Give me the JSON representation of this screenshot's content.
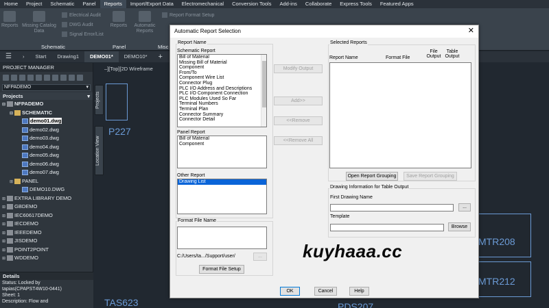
{
  "ribbon": {
    "tabs": [
      "Home",
      "Project",
      "Schematic",
      "Panel",
      "Reports",
      "Import/Export Data",
      "Electromechanical",
      "Conversion Tools",
      "Add-ins",
      "Collaborate",
      "Express Tools",
      "Featured Apps"
    ],
    "active_tab": "Reports",
    "buttons": {
      "reports": "Reports",
      "missing_catalog_data": "Missing Catalog Data",
      "electrical_audit": "Electrical Audit",
      "dwg_audit": "DWG Audit",
      "signal_error_list": "Signal Error/List",
      "reports_panel": "Reports",
      "automatic_reports": "Automatic Reports",
      "report_format_setup": "Report Format Setup"
    },
    "groups": {
      "schematic": "Schematic",
      "panel": "Panel",
      "misc": "Misc"
    }
  },
  "file_tabs": [
    "Start",
    "Drawing1",
    "DEMO01*",
    "DEMO10*"
  ],
  "active_file_tab": "DEMO01*",
  "viewport_label": "–][Top][2D Wireframe",
  "project_manager": {
    "title": "PROJECT MANAGER",
    "selected_project": "NFPADEMO",
    "projects_label": "Projects",
    "side_tabs": {
      "projects": "Projects",
      "location_view": "Location View"
    },
    "tree": [
      {
        "label": "NFPADEMO",
        "level": 0,
        "type": "proj",
        "bold": true,
        "expanded": true
      },
      {
        "label": "SCHEMATIC",
        "level": 1,
        "type": "folder",
        "bold": true,
        "expanded": true
      },
      {
        "label": "demo01.dwg",
        "level": 2,
        "type": "dwg",
        "bold": true,
        "selected": true
      },
      {
        "label": "demo02.dwg",
        "level": 2,
        "type": "dwg"
      },
      {
        "label": "demo03.dwg",
        "level": 2,
        "type": "dwg"
      },
      {
        "label": "demo04.dwg",
        "level": 2,
        "type": "dwg"
      },
      {
        "label": "demo05.dwg",
        "level": 2,
        "type": "dwg"
      },
      {
        "label": "demo06.dwg",
        "level": 2,
        "type": "dwg"
      },
      {
        "label": "demo07.dwg",
        "level": 2,
        "type": "dwg"
      },
      {
        "label": "PANEL",
        "level": 1,
        "type": "folder",
        "collapsed": true
      },
      {
        "label": "DEMO10.DWG",
        "level": 2,
        "type": "dwg"
      },
      {
        "label": "EXTRA LIBRARY DEMO",
        "level": 0,
        "type": "proj",
        "collapsed": true
      },
      {
        "label": "GBDEMO",
        "level": 0,
        "type": "proj",
        "collapsed": true
      },
      {
        "label": "IEC60617DEMO",
        "level": 0,
        "type": "proj",
        "collapsed": true
      },
      {
        "label": "IECDEMO",
        "level": 0,
        "type": "proj",
        "collapsed": true
      },
      {
        "label": "IEEEDEMO",
        "level": 0,
        "type": "proj",
        "collapsed": true
      },
      {
        "label": "JISDEMO",
        "level": 0,
        "type": "proj",
        "collapsed": true
      },
      {
        "label": "POINT2POINT",
        "level": 0,
        "type": "proj",
        "collapsed": true
      },
      {
        "label": "WDDEMO",
        "level": 0,
        "type": "proj",
        "collapsed": true
      }
    ],
    "details_title": "Details",
    "details_lines": [
      "Status: Locked by",
      "tapias(CPAPST4W10-0441)",
      "Sheet: 1",
      "Description: Flow and"
    ]
  },
  "canvas_labels": {
    "p227": "P227",
    "mtr208": "MTR208",
    "mtr212": "MTR212",
    "tas623": "TAS623",
    "pds207": "PDS207"
  },
  "watermark": "kuyhaaa.cc",
  "dialog": {
    "title": "Automatic Report Selection",
    "report_name_label": "Report Name",
    "schematic_report_label": "Schematic Report",
    "schematic_reports": [
      "Bill of Material",
      "Missing Bill of Material",
      "Component",
      "From/To",
      "Component Wire List",
      "Connector Plug",
      "PLC I/O Address and Descriptions",
      "PLC I/O Component Connection",
      "PLC Modules Used So Far",
      "Terminal Numbers",
      "Terminal Plan",
      "Connector Summary",
      "Connector Detail"
    ],
    "panel_report_label": "Panel Report",
    "panel_reports": [
      "Bill of Material",
      "Component"
    ],
    "other_report_label": "Other Report",
    "other_reports": [
      "Drawing List"
    ],
    "other_selected": "Drawing List",
    "format_file_name_label": "Format File Name",
    "format_path": "C:/Users/ta.../Support/user/",
    "browse_dots": "...",
    "format_file_setup_button": "Format File Setup",
    "modify_output_button": "Modify Output",
    "add_button": "Add>>",
    "remove_button": "<<Remove",
    "remove_all_button": "<<Remove All",
    "selected_reports_label": "Selected Reports",
    "columns": {
      "report_name": "Report Name",
      "format_file": "Format File",
      "file_output": "File Output",
      "table_output": "Table Output"
    },
    "open_grouping_button": "Open Report Grouping",
    "save_grouping_button": "Save Report Grouping",
    "drawing_info_label": "Drawing Information for Table Output",
    "first_drawing_label": "First Drawing Name",
    "first_drawing_value": "",
    "template_label": "Template",
    "template_value": "",
    "browse_button": "Browse",
    "ok_button": "OK",
    "cancel_button": "Cancel",
    "help_button": "Help"
  }
}
